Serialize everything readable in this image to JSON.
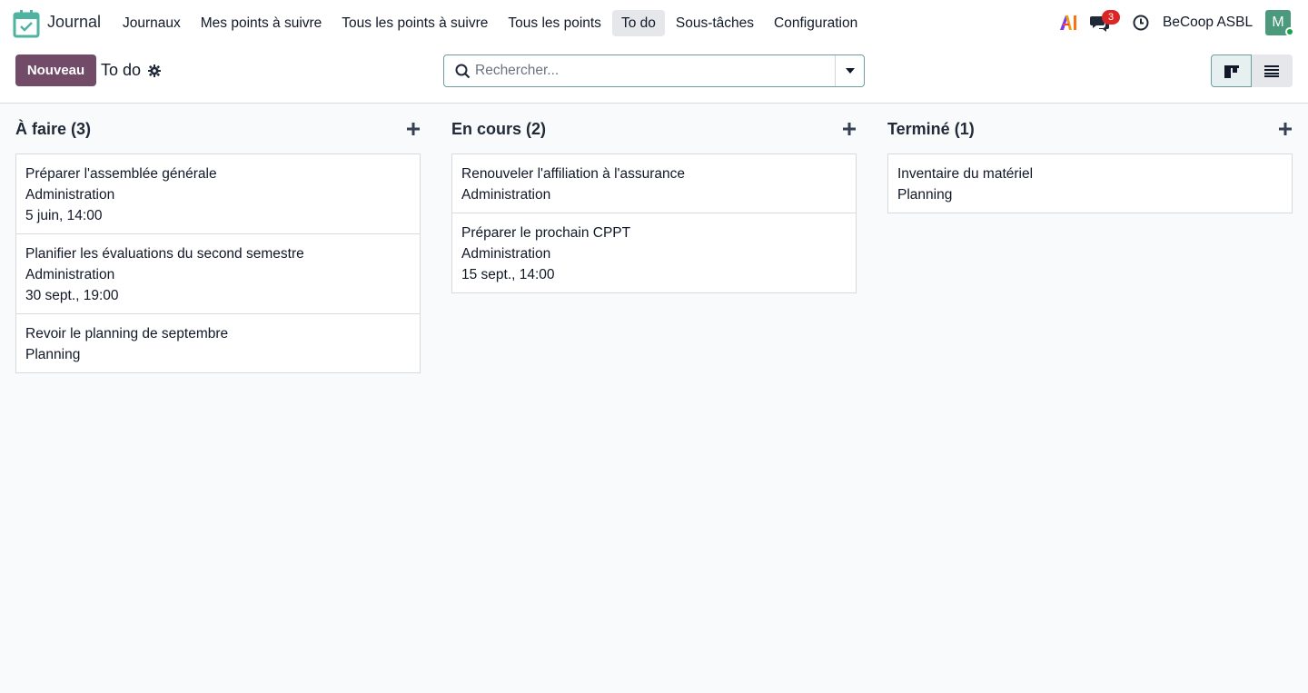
{
  "app": {
    "name": "Journal",
    "nav_items": [
      "Journaux",
      "Mes points à suivre",
      "Tous les points à suivre",
      "Tous les points",
      "To do",
      "Sous-tâches",
      "Configuration"
    ],
    "active_nav": "To do",
    "colors": {
      "brand": "#714b67",
      "logo": "#4fb3a1",
      "badge": "#dc2626",
      "avatar": "#4c9a7e"
    }
  },
  "systray": {
    "ai_icon": "ai-icon",
    "chat_badge": "3",
    "company": "BeCoop ASBL",
    "avatar_initial": "M"
  },
  "control_panel": {
    "new_button": "Nouveau",
    "title": "To do",
    "search_placeholder": "Rechercher..."
  },
  "kanban": {
    "columns": [
      {
        "title": "À faire",
        "count": "(3)",
        "cards": [
          {
            "title": "Préparer l'assemblée générale",
            "tag": "Administration",
            "date": "5 juin, 14:00"
          },
          {
            "title": "Planifier les évaluations du second semestre",
            "tag": "Administration",
            "date": "30 sept., 19:00"
          },
          {
            "title": "Revoir le planning de septembre",
            "tag": "Planning",
            "date": ""
          }
        ]
      },
      {
        "title": "En cours",
        "count": "(2)",
        "cards": [
          {
            "title": "Renouveler l'affiliation à l'assurance",
            "tag": "Administration",
            "date": ""
          },
          {
            "title": "Préparer le prochain CPPT",
            "tag": "Administration",
            "date": "15 sept., 14:00"
          }
        ]
      },
      {
        "title": "Terminé",
        "count": "(1)",
        "cards": [
          {
            "title": "Inventaire du matériel",
            "tag": "Planning",
            "date": ""
          }
        ]
      }
    ]
  }
}
